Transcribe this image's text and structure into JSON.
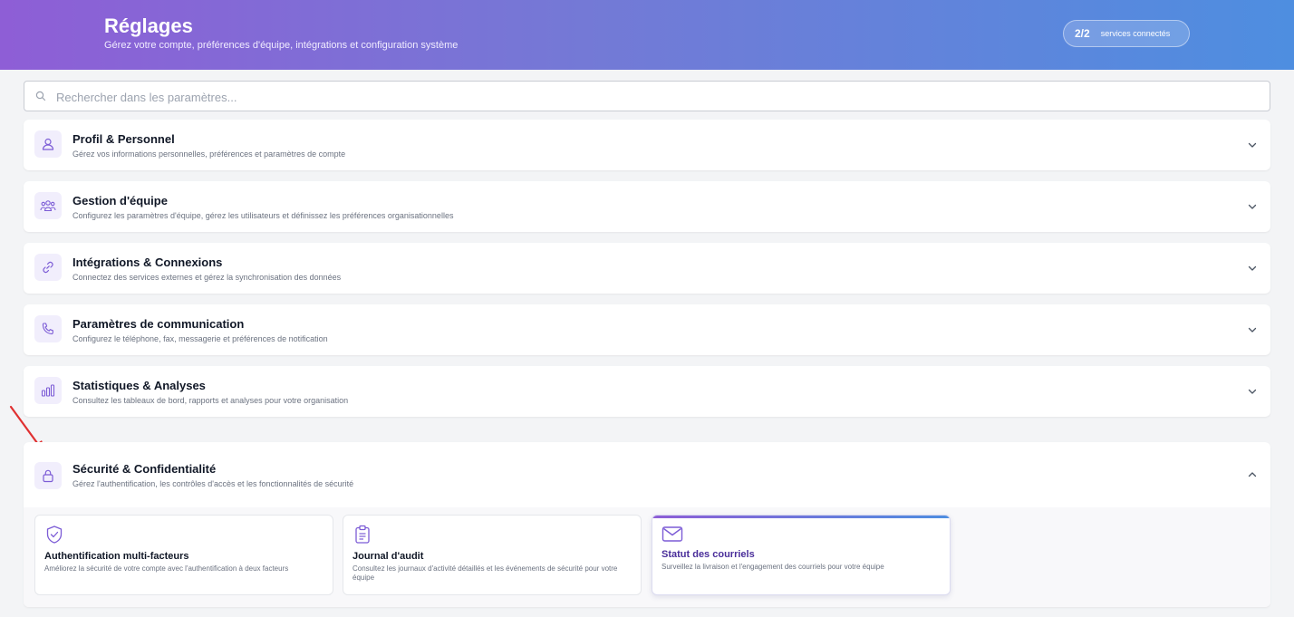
{
  "header": {
    "title": "Réglages",
    "subtitle": "Gérez votre compte, préférences d'équipe, intégrations et configuration système",
    "services_count": "2/2",
    "services_label": "services connectés"
  },
  "search": {
    "placeholder": "Rechercher dans les paramètres..."
  },
  "sections": [
    {
      "title": "Profil & Personnel",
      "description": "Gérez vos informations personnelles, préférences et paramètres de compte",
      "icon": "user-icon",
      "expanded": false
    },
    {
      "title": "Gestion d'équipe",
      "description": "Configurez les paramètres d'équipe, gérez les utilisateurs et définissez les préférences organisationnelles",
      "icon": "team-icon",
      "expanded": false
    },
    {
      "title": "Intégrations & Connexions",
      "description": "Connectez des services externes et gérez la synchronisation des données",
      "icon": "link-icon",
      "expanded": false
    },
    {
      "title": "Paramètres de communication",
      "description": "Configurez le téléphone, fax, messagerie et préférences de notification",
      "icon": "phone-icon",
      "expanded": false
    },
    {
      "title": "Statistiques & Analyses",
      "description": "Consultez les tableaux de bord, rapports et analyses pour votre organisation",
      "icon": "bar-chart-icon",
      "expanded": false
    }
  ],
  "security": {
    "title": "Sécurité & Confidentialité",
    "description": "Gérez l'authentification, les contrôles d'accès et les fonctionnalités de sécurité",
    "icon": "lock-icon",
    "expanded": true,
    "items": [
      {
        "title": "Authentification multi-facteurs",
        "description": "Améliorez la sécurité de votre compte avec l'authentification à deux facteurs",
        "icon": "shield-check-icon"
      },
      {
        "title": "Journal d'audit",
        "description": "Consultez les journaux d'activité détaillés et les événements de sécurité pour votre équipe",
        "icon": "clipboard-icon"
      },
      {
        "title": "Statut des courriels",
        "description": "Surveillez la livraison et l'engagement des courriels pour votre équipe",
        "icon": "mail-icon",
        "active": true
      }
    ]
  },
  "colors": {
    "accent": "#7c5cd6",
    "header_gradient_start": "#8e5ed6",
    "header_gradient_end": "#4e8ee0",
    "annotation_arrow": "#e03131"
  }
}
